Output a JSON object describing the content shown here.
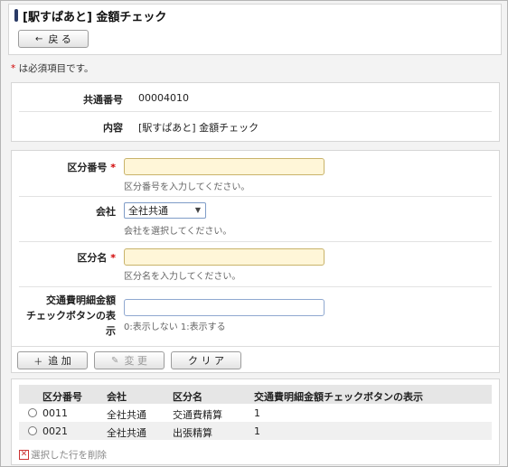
{
  "page": {
    "title": "[駅すぱあと] 金額チェック",
    "back_label": "戻 る"
  },
  "required_note": {
    "star": "*",
    "text": " は必須項目です。"
  },
  "info": {
    "common_no_label": "共通番号",
    "common_no_value": "00004010",
    "content_label": "内容",
    "content_value": "[駅すぱあと] 金額チェック"
  },
  "form": {
    "kubun_no_label": "区分番号",
    "kubun_no_hint": "区分番号を入力してください。",
    "company_label": "会社",
    "company_selected": "全社共通",
    "company_hint": "会社を選択してください。",
    "kubun_name_label": "区分名",
    "kubun_name_hint": "区分名を入力してください。",
    "check_label_line1": "交通費明細金額",
    "check_label_line2": "チェックボタンの表",
    "check_label_line3": "示",
    "check_hint": "0:表示しない 1:表示する",
    "required_star": "*"
  },
  "actions": {
    "add_label": "追 加",
    "change_label": "変 更",
    "clear_label": "ク リ ア"
  },
  "table": {
    "headers": [
      "区分番号",
      "会社",
      "区分名",
      "交通費明細金額チェックボタンの表示"
    ],
    "rows": [
      [
        "0011",
        "全社共通",
        "交通費精算",
        "1"
      ],
      [
        "0021",
        "全社共通",
        "出張精算",
        "1"
      ]
    ]
  },
  "delete_selected_label": "選択した行を削除",
  "colors": {
    "required_input_bg": "#fff6d8",
    "title_accent": "#2a3a66",
    "required_star": "#d00000"
  }
}
